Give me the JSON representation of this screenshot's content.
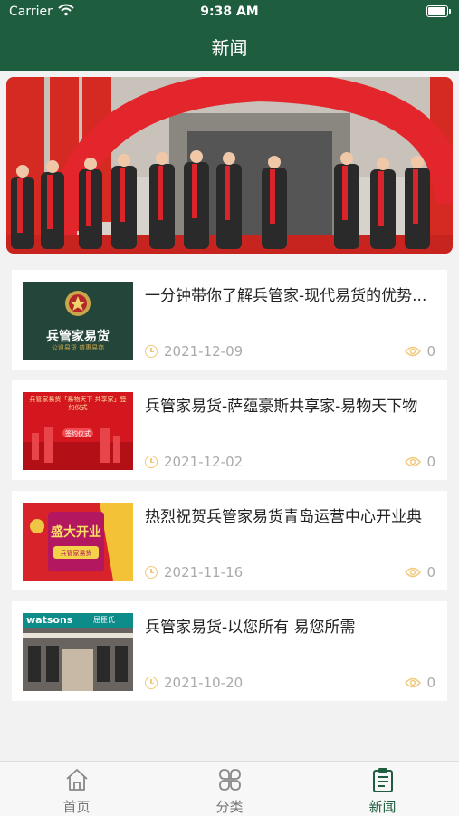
{
  "status_bar": {
    "carrier": "Carrier",
    "time": "9:38 AM",
    "battery_level": 1.0
  },
  "header": {
    "title": "新闻"
  },
  "news": [
    {
      "title": "一分钟带你了解兵管家-现代易货的优势...",
      "date": "2021-12-09",
      "views": "0",
      "thumb_text": "兵管家易货",
      "thumb_sub": "公道易货   普惠易商"
    },
    {
      "title": "兵管家易货-萨蕴豪斯共享家-易物天下物",
      "date": "2021-12-02",
      "views": "0",
      "thumb_text": "兵管家易货「易物天下 共享家」签约仪式",
      "thumb_sub": "签约仪式"
    },
    {
      "title": "热烈祝贺兵管家易货青岛运营中心开业典",
      "date": "2021-11-16",
      "views": "0",
      "thumb_text": "盛大开业",
      "thumb_sub": "兵管家易货"
    },
    {
      "title": "兵管家易货-以您所有 易您所需",
      "date": "2021-10-20",
      "views": "0",
      "thumb_text": "watsons",
      "thumb_sub": "屈臣氏"
    }
  ],
  "tabbar": [
    {
      "label": "首页",
      "icon": "home-icon"
    },
    {
      "label": "分类",
      "icon": "category-icon"
    },
    {
      "label": "新闻",
      "icon": "news-icon"
    }
  ],
  "colors": {
    "primary": "#1f5d3f",
    "accent_gold": "#f2c87a",
    "banner_red": "#e3262c"
  }
}
